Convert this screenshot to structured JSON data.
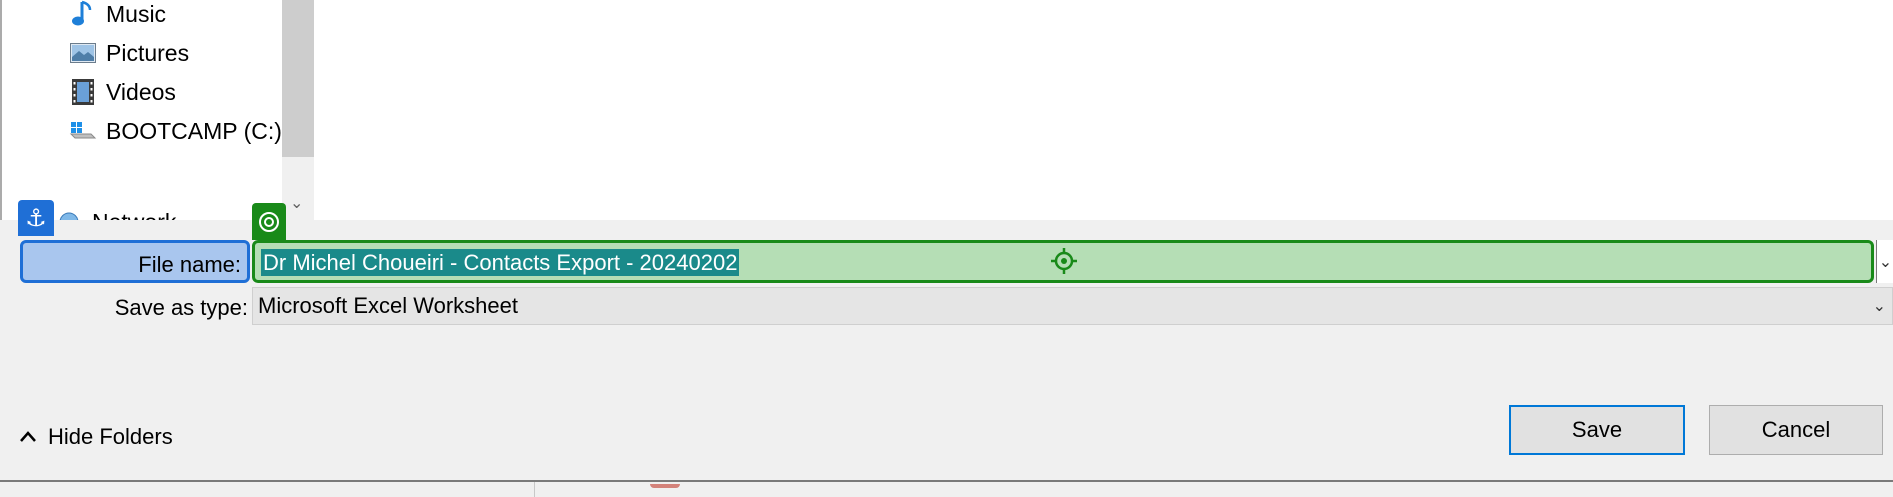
{
  "nav": {
    "items": [
      {
        "label": "Music",
        "icon": "music-note-icon"
      },
      {
        "label": "Pictures",
        "icon": "pictures-icon"
      },
      {
        "label": "Videos",
        "icon": "videos-icon"
      },
      {
        "label": "BOOTCAMP (C:)",
        "icon": "drive-icon"
      },
      {
        "label": "Network",
        "icon": "network-icon"
      }
    ]
  },
  "form": {
    "filename_label": "File name:",
    "filename_value": "Dr Michel Choueiri - Contacts Export - 20240202",
    "savetype_label": "Save as type:",
    "savetype_value": "Microsoft Excel Worksheet"
  },
  "footer": {
    "hide_folders_label": "Hide Folders",
    "save_label": "Save",
    "cancel_label": "Cancel"
  },
  "colors": {
    "anchor_badge": "#1f6fd6",
    "target_badge": "#198a19",
    "selection": "#1a8a8a"
  }
}
